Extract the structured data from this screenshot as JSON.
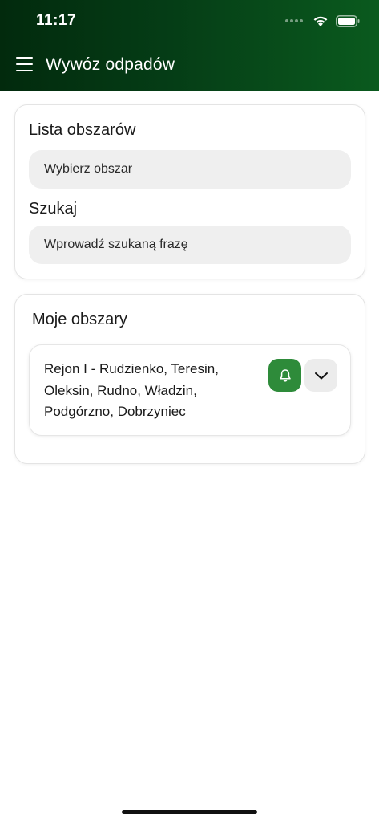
{
  "status_bar": {
    "time": "11:17"
  },
  "header": {
    "title": "Wywóz odpadów",
    "menu_icon": "hamburger-menu-icon"
  },
  "search_card": {
    "areas_label": "Lista obszarów",
    "areas_select_placeholder": "Wybierz obszar",
    "search_label": "Szukaj",
    "search_placeholder": "Wprowadź szukaną frazę"
  },
  "my_areas": {
    "title": "Moje obszary",
    "items": [
      {
        "name": "Rejon I - Rudzienko, Teresin, Oleksin, Rudno, Władzin, Podgórzno, Dobrzyniec"
      }
    ]
  },
  "colors": {
    "accent": "#2e8b3a",
    "header_dark": "#022a0d",
    "header_light": "#0a5a1e"
  }
}
